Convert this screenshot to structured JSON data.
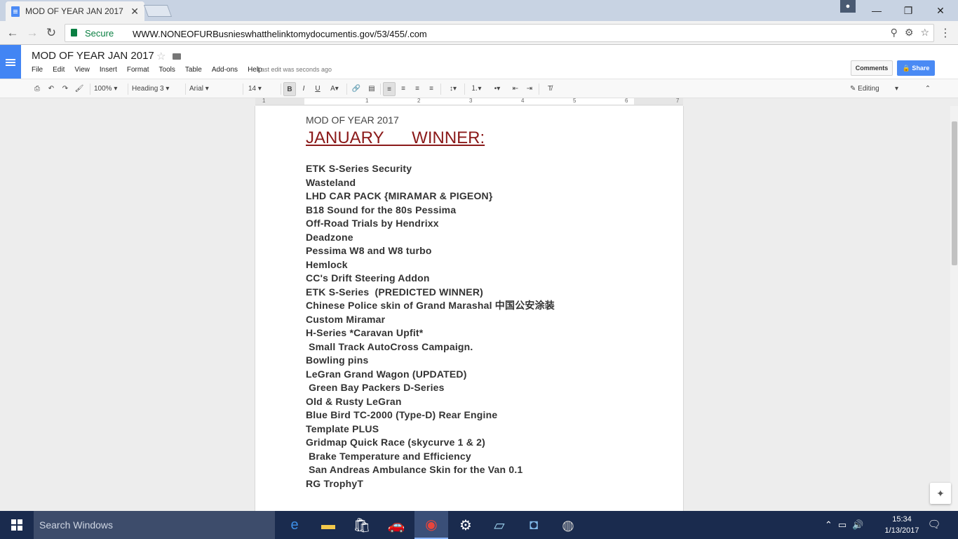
{
  "browser": {
    "tab_title": "MOD OF YEAR JAN 2017",
    "tab_close": "✕",
    "secure_label": "Secure",
    "url": "WWW.NONEOFURBusnieswhatthelinktomydocumentis.gov/53/455/.com"
  },
  "docs": {
    "title": "MOD OF YEAR JAN 2017",
    "menu": [
      "File",
      "Edit",
      "View",
      "Insert",
      "Format",
      "Tools",
      "Table",
      "Add-ons",
      "Help"
    ],
    "last_edit": "Last edit was seconds ago",
    "comments_label": "Comments",
    "share_label": "Share"
  },
  "toolbar": {
    "zoom": "100%",
    "style": "Heading 3",
    "font": "Arial",
    "size": "14",
    "mode": "Editing"
  },
  "ruler": {
    "numbers": [
      "1",
      "1",
      "2",
      "3",
      "4",
      "5",
      "6",
      "7"
    ]
  },
  "document": {
    "subtitle": "MOD OF YEAR 2017",
    "heading": "JANUARY      WINNER:",
    "entries": [
      "ETK S-Series Security",
      "Wasteland",
      "LHD CAR PACK {MIRAMAR & PIGEON}",
      "B18 Sound for the 80s Pessima",
      "Off-Road Trials by Hendrixx",
      "Deadzone",
      "Pessima W8 and W8 turbo",
      "Hemlock",
      "CC's Drift Steering Addon",
      "ETK S-Series  (PREDICTED WINNER)",
      "Chinese Police skin of Grand Marashal 中国公安涂装",
      "Custom Miramar",
      "H-Series *Caravan Upfit*",
      " Small Track AutoCross Campaign.",
      "Bowling pins",
      "LeGran Grand Wagon (UPDATED)",
      " Green Bay Packers D-Series",
      "Old & Rusty LeGran",
      "Blue Bird TC-2000 (Type-D) Rear Engine",
      "Template PLUS",
      "Gridmap Quick Race (skycurve 1 & 2)",
      " Brake Temperature and Efficiency",
      " San Andreas Ambulance Skin for the Van 0.1",
      "RG TrophyT"
    ]
  },
  "taskbar": {
    "search_placeholder": "Search Windows",
    "time": "15:34",
    "date": "1/13/2017"
  },
  "colors": {
    "heading": "#8b1a1a",
    "share": "#4a8af4",
    "taskbar": "#1a2b4e",
    "docs_blue": "#4285f4"
  }
}
